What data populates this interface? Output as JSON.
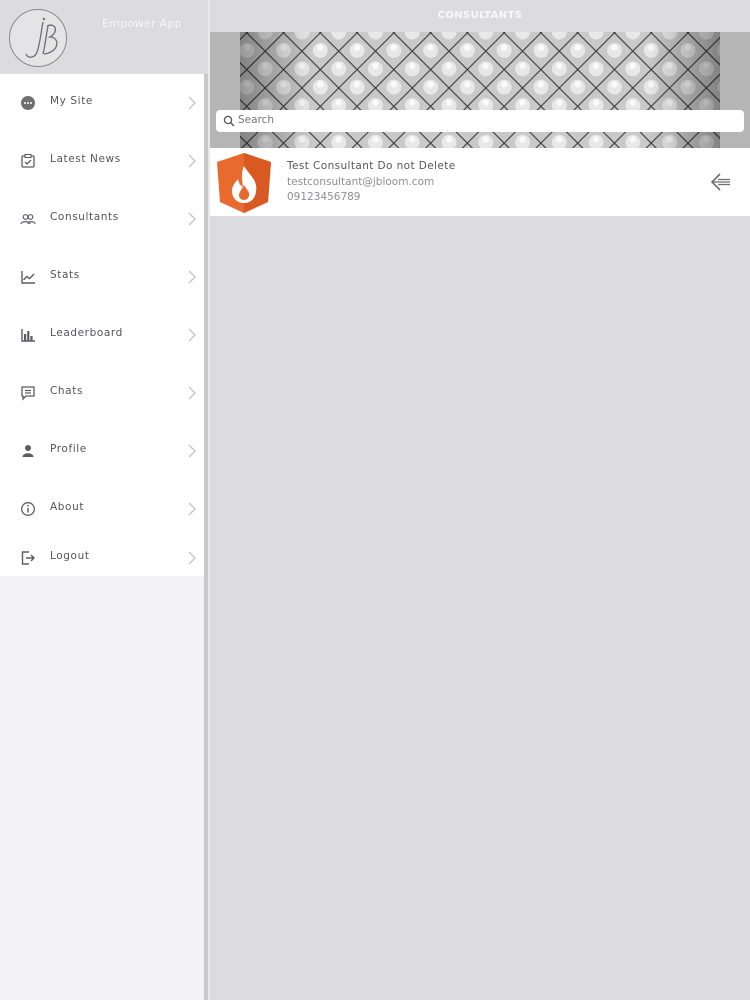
{
  "sidebar": {
    "logo_text": "jB",
    "app_title": "Empower App",
    "items": [
      {
        "label": "My Site",
        "icon": "globe-icon"
      },
      {
        "label": "Latest News",
        "icon": "news-icon"
      },
      {
        "label": "Consultants",
        "icon": "people-icon"
      },
      {
        "label": "Stats",
        "icon": "line-chart-icon"
      },
      {
        "label": "Leaderboard",
        "icon": "bar-chart-icon"
      },
      {
        "label": "Chats",
        "icon": "chat-icon"
      },
      {
        "label": "Profile",
        "icon": "person-icon"
      },
      {
        "label": "About",
        "icon": "info-icon"
      },
      {
        "label": "Logout",
        "icon": "logout-icon"
      }
    ]
  },
  "header": {
    "title": "CONSULTANTS"
  },
  "search": {
    "placeholder": "Search"
  },
  "consultants": [
    {
      "name": "Test Consultant Do not Delete",
      "email": "testconsultant@jbloom.com",
      "phone": "09123456789",
      "avatar_icon": "flame-icon",
      "action_icon": "back-arrow-icon"
    }
  ],
  "colors": {
    "avatar_orange": "#e96a2e",
    "background": "#dcdbdd",
    "menu_bg": "#ffffff"
  }
}
